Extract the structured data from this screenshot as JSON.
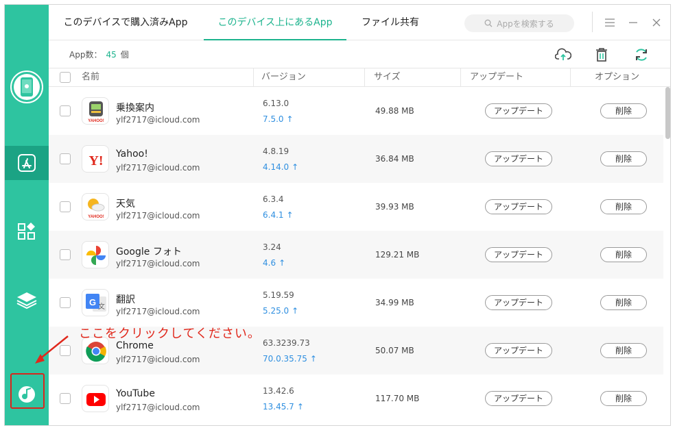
{
  "tabs": {
    "purchased": "このデバイスで購入済みApp",
    "on_device": "このデバイス上にあるApp",
    "file_share": "ファイル共有"
  },
  "search": {
    "placeholder": "Appを検索する"
  },
  "app_count": {
    "label": "App数：",
    "value": "45",
    "unit": "個"
  },
  "columns": {
    "name": "名前",
    "version": "バージョン",
    "size": "サイズ",
    "update": "アップデート",
    "option": "オプション"
  },
  "buttons": {
    "update": "アップデート",
    "delete": "削除"
  },
  "apps": [
    {
      "name": "乗換案内",
      "account": "ylf2717@icloud.com",
      "version": "6.13.0",
      "new_version": "7.5.0",
      "size": "49.88 MB",
      "icon": "train-icon"
    },
    {
      "name": "Yahoo!",
      "account": "ylf2717@icloud.com",
      "version": "4.8.19",
      "new_version": "4.14.0",
      "size": "36.84 MB",
      "icon": "yahoo-icon"
    },
    {
      "name": "天気",
      "account": "ylf2717@icloud.com",
      "version": "6.3.4",
      "new_version": "6.4.1",
      "size": "39.93 MB",
      "icon": "weather-icon"
    },
    {
      "name": "Google フォト",
      "account": "ylf2717@icloud.com",
      "version": "3.24",
      "new_version": "4.6",
      "size": "129.21 MB",
      "icon": "google-photos-icon"
    },
    {
      "name": "翻訳",
      "account": "ylf2717@icloud.com",
      "version": "5.19.59",
      "new_version": "5.25.0",
      "size": "34.99 MB",
      "icon": "google-translate-icon"
    },
    {
      "name": "Chrome",
      "account": "ylf2717@icloud.com",
      "version": "63.3239.73",
      "new_version": "70.0.35.75",
      "size": "50.07 MB",
      "icon": "chrome-icon"
    },
    {
      "name": "YouTube",
      "account": "ylf2717@icloud.com",
      "version": "13.42.6",
      "new_version": "13.45.7",
      "size": "117.70 MB",
      "icon": "youtube-icon"
    }
  ],
  "annotation": "ここをクリックしてください。",
  "icon_labels": {
    "yahoo_small": "YAHOO!"
  },
  "colors": {
    "accent": "#2ec4a0",
    "accent_dark": "#1ba384",
    "link_blue": "#2f8fe0",
    "annotation_red": "#e0281c"
  }
}
